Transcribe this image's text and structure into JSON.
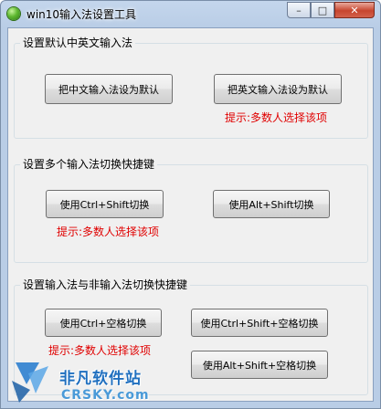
{
  "window": {
    "title": "win10输入法设置工具",
    "minimize_glyph": "–",
    "maximize_glyph": "□",
    "close_glyph": "✕"
  },
  "group1": {
    "title": "设置默认中英文输入法",
    "btn_chinese": "把中文输入法设为默认",
    "btn_english": "把英文输入法设为默认",
    "hint": "提示:多数人选择该项"
  },
  "group2": {
    "title": "设置多个输入法切换快捷键",
    "btn_ctrl_shift": "使用Ctrl+Shift切换",
    "btn_alt_shift": "使用Alt+Shift切换",
    "hint": "提示:多数人选择该项"
  },
  "group3": {
    "title": "设置输入法与非输入法切换快捷键",
    "btn_ctrl_space": "使用Ctrl+空格切换",
    "btn_ctrl_shift_space": "使用Ctrl+Shift+空格切换",
    "btn_alt_shift_space": "使用Alt+Shift+空格切换",
    "hint": "提示:多数人选择该项"
  },
  "watermark": {
    "name": "非凡软件站",
    "domain": "CRSKY.com"
  }
}
